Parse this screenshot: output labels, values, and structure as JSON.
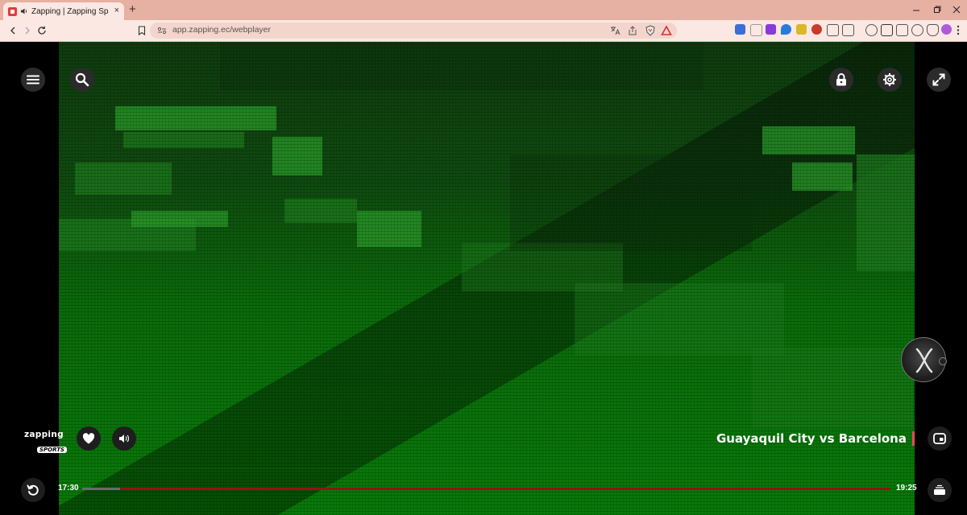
{
  "browser": {
    "tab_title": "Zapping | Zapping Sports+",
    "tab_close": "×",
    "new_tab": "+",
    "url": "app.zapping.ec/webplayer"
  },
  "player": {
    "brand_main": "zapping",
    "brand_sub": "SPORTS",
    "match_title": "Guayaquil City vs Barcelona",
    "time_start": "17:30",
    "time_end": "19:25",
    "progress_played": 0.047,
    "colors": {
      "accent_red": "#9b1010",
      "live_marker": "#e34b5a",
      "video_green": "#087a08"
    }
  }
}
